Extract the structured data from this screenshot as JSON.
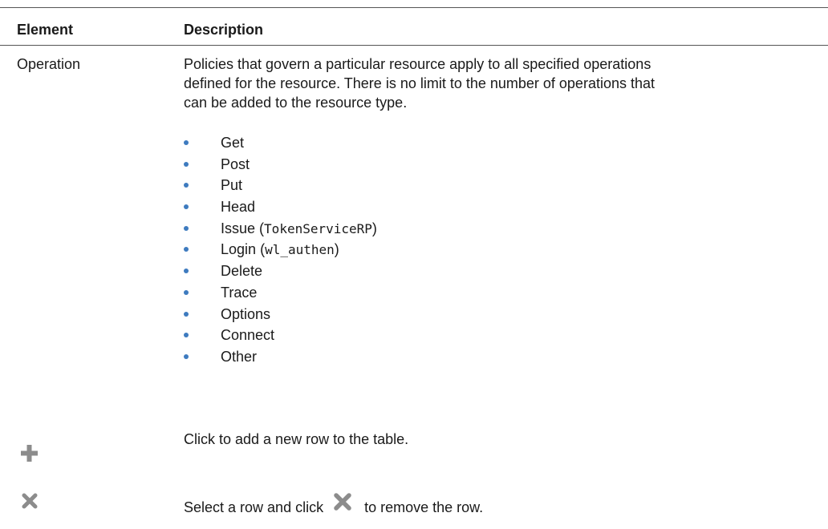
{
  "table": {
    "headers": {
      "element": "Element",
      "description": "Description"
    },
    "rows": {
      "operation": {
        "element": "Operation",
        "description_lines": [
          "Policies that govern a particular resource apply to all specified operations",
          "defined for the resource. There is no limit to the number of operations that",
          "can be added to the resource type."
        ],
        "operations": [
          {
            "label": "Get",
            "code": ""
          },
          {
            "label": "Post",
            "code": ""
          },
          {
            "label": "Put",
            "code": ""
          },
          {
            "label": "Head",
            "code": ""
          },
          {
            "label": "Issue",
            "code": "TokenServiceRP"
          },
          {
            "label": "Login",
            "code": "wl_authen"
          },
          {
            "label": "Delete",
            "code": ""
          },
          {
            "label": "Trace",
            "code": ""
          },
          {
            "label": "Options",
            "code": ""
          },
          {
            "label": "Connect",
            "code": ""
          },
          {
            "label": "Other",
            "code": ""
          }
        ]
      },
      "add": {
        "icon": "plus-icon",
        "description": "Click to add a new row to the table."
      },
      "remove": {
        "icon": "x-icon",
        "description_before": "Select a row and click",
        "description_after": "to remove the row."
      }
    }
  },
  "colors": {
    "bullet": "#3e7bbf",
    "icon_gray": "#8c8c8c",
    "rule": "#555555",
    "text": "#1a1a1a"
  }
}
